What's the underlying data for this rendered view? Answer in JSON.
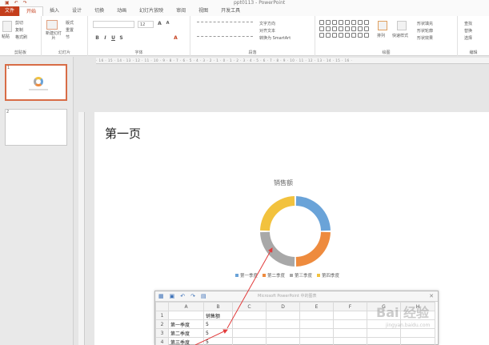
{
  "window": {
    "title": "ppt0113 - PowerPoint"
  },
  "tabs": [
    {
      "label": "文件"
    },
    {
      "label": "开始"
    },
    {
      "label": "插入"
    },
    {
      "label": "设计"
    },
    {
      "label": "切换"
    },
    {
      "label": "动画"
    },
    {
      "label": "幻灯片放映"
    },
    {
      "label": "审阅"
    },
    {
      "label": "视图"
    },
    {
      "label": "开发工具"
    }
  ],
  "ribbon": {
    "clipboard": {
      "label": "剪贴板",
      "paste": "粘贴",
      "cut": "剪切",
      "copy": "复制",
      "format_painter": "格式刷"
    },
    "slides": {
      "label": "幻灯片",
      "new_slide": "新建幻灯片",
      "layout": "版式",
      "reset": "重置",
      "section": "节"
    },
    "font": {
      "label": "字体",
      "size": "12"
    },
    "paragraph": {
      "label": "段落",
      "text_direction": "文字方向",
      "align_text": "对齐文本",
      "smartart": "转换为 SmartArt"
    },
    "drawing": {
      "label": "绘图",
      "arrange": "排列",
      "quick_styles": "快速样式",
      "shape_fill": "形状填充",
      "shape_outline": "形状轮廓",
      "shape_effects": "形状效果"
    },
    "editing": {
      "label": "编辑",
      "find": "查找",
      "replace": "替换",
      "select": "选择"
    }
  },
  "thumbnails": [
    {
      "num": "1"
    },
    {
      "num": "2"
    }
  ],
  "slide": {
    "title": "第一页",
    "chart_title": "销售额",
    "legend": [
      {
        "name": "第一季度",
        "color": "#6aa3d8"
      },
      {
        "name": "第二季度",
        "color": "#ee8b3e"
      },
      {
        "name": "第三季度",
        "color": "#a8a8a8"
      },
      {
        "name": "第四季度",
        "color": "#f2c23e"
      }
    ]
  },
  "chart_data": {
    "type": "pie",
    "title": "销售额",
    "categories": [
      "第一季度",
      "第二季度",
      "第三季度",
      "第四季度"
    ],
    "values": [
      5,
      5,
      5,
      5
    ],
    "legend": "bottom",
    "colors": [
      "#6aa3d8",
      "#ee8b3e",
      "#a8a8a8",
      "#f2c23e"
    ]
  },
  "sheet": {
    "title": "Microsoft PowerPoint 中的图表",
    "columns": [
      "A",
      "B",
      "C",
      "D",
      "E",
      "F",
      "G",
      "H"
    ],
    "rows": [
      {
        "num": "1",
        "a": "",
        "b": "销售额"
      },
      {
        "num": "2",
        "a": "第一季度",
        "b": "5"
      },
      {
        "num": "3",
        "a": "第二季度",
        "b": "5"
      },
      {
        "num": "4",
        "a": "第三季度",
        "b": "5"
      }
    ]
  },
  "ruler_text": "· 16 · 15 · 14 · 13 · 12 · 11 · 10 · 9 · 8 · 7 · 6 · 5 · 4 · 3 · 2 · 1 · 0 · 1 · 2 · 3 · 4 · 5 · 6 · 7 · 8 · 9 · 10 · 11 · 12 · 13 · 14 · 15 · 16 ·",
  "watermark": {
    "main": "Bai 经验",
    "sub": "jingyan.baidu.com"
  }
}
